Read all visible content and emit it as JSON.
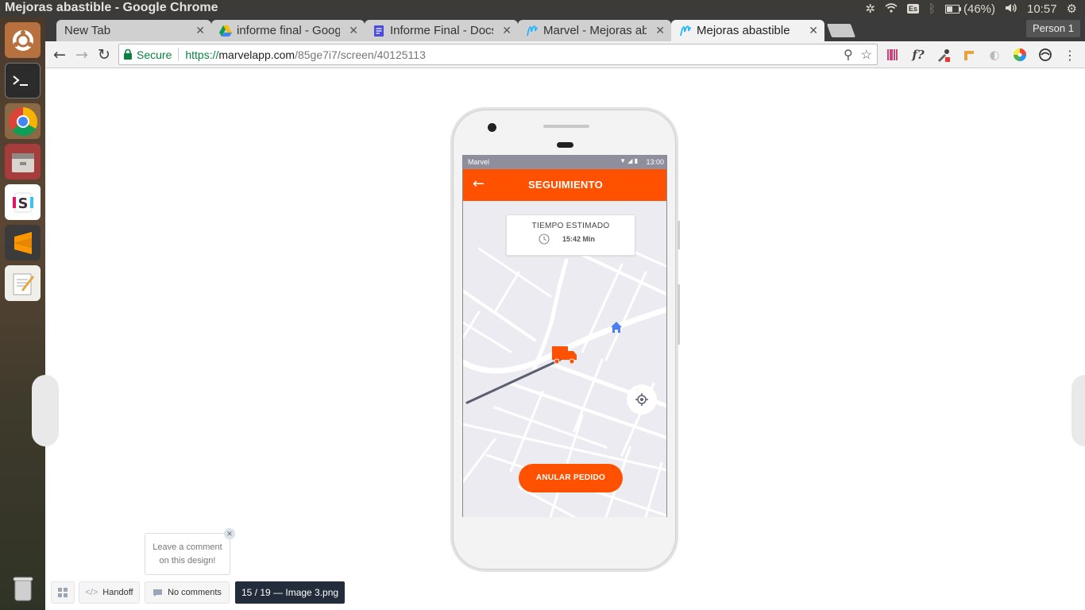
{
  "os": {
    "window_title": "Mejoras abastible - Google Chrome",
    "keyboard_layout": "Es",
    "battery": "(46%)",
    "clock": "10:57"
  },
  "browser": {
    "tabs": [
      {
        "label": "New Tab",
        "icon": "blank"
      },
      {
        "label": "informe final - Goog",
        "icon": "google-drive-icon"
      },
      {
        "label": "Informe Final - Docs",
        "icon": "google-docs-icon"
      },
      {
        "label": "Marvel - Mejoras ab",
        "icon": "marvel-icon"
      },
      {
        "label": "Mejoras abastible",
        "icon": "marvel-icon",
        "active": true
      }
    ],
    "profile": "Person 1",
    "secure_label": "Secure",
    "url_scheme": "https://",
    "url_host": "marvelapp.com",
    "url_path": "/85ge7i7/screen/40125113"
  },
  "app": {
    "status_carrier": "Marvel",
    "status_time": "13:00",
    "title": "SEGUIMIENTO",
    "eta_title": "TIEMPO ESTIMADO",
    "eta_value": "15:42 Min",
    "cancel_label": "ANULAR PEDIDO",
    "accent_color": "#ff5100"
  },
  "marvel_ui": {
    "comment_prompt_line1": "Leave a comment",
    "comment_prompt_line2": "on this design!",
    "handoff_label": "Handoff",
    "comments_label": "No comments",
    "screen_label": "15 / 19 — Image 3.png"
  }
}
